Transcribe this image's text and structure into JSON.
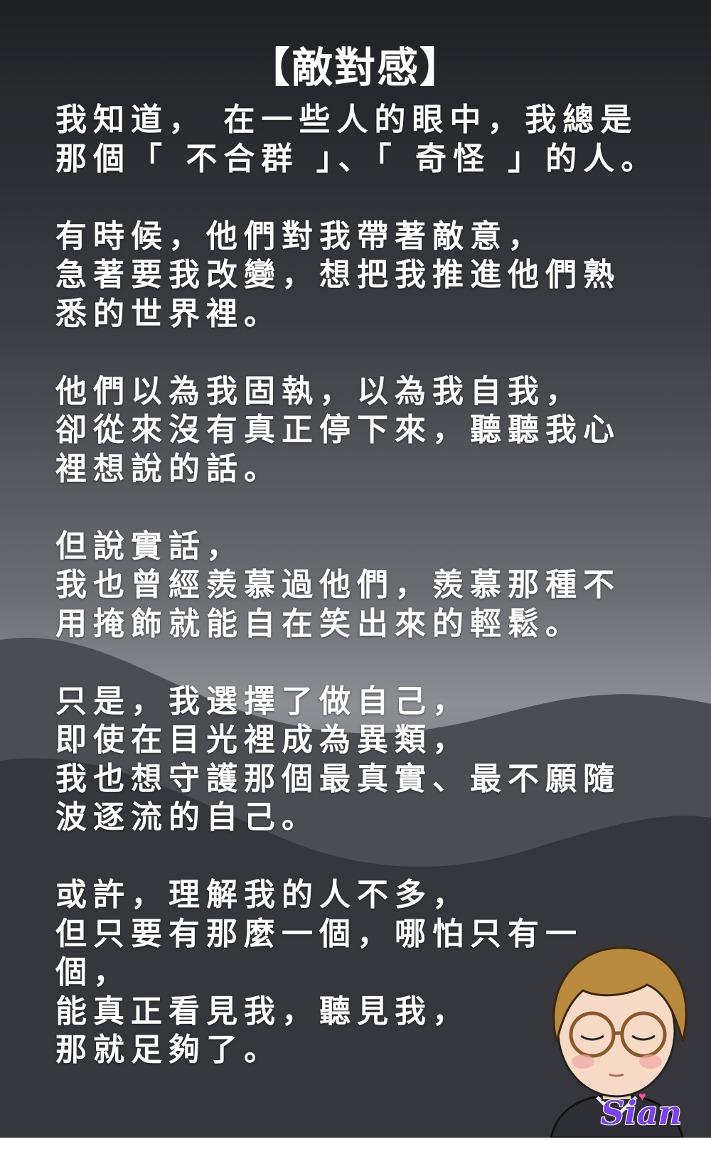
{
  "title": "【敵對感】",
  "stanzas": [
    [
      "我知道， 在一些人的眼中，我總是",
      "那個「 不合群 」、「 奇怪 」的人。"
    ],
    [
      "有時候，他們對我帶著敵意，",
      "急著要我改變，想把我推進他們熟",
      "悉的世界裡。"
    ],
    [
      "他們以為我固執，以為我自我，",
      "卻從來沒有真正停下來，聽聽我心",
      "裡想說的話。"
    ],
    [
      "但說實話，",
      "我也曾經羨慕過他們，羨慕那種不",
      "用掩飾就能自在笑出來的輕鬆。"
    ],
    [
      "只是，我選擇了做自己，",
      "即使在目光裡成為異類，",
      "我也想守護那個最真實、最不願隨",
      "波逐流的自己。"
    ],
    [
      "或許，理解我的人不多，",
      "但只要有那麼一個，哪怕只有一",
      "個，",
      "能真正看見我，聽見我，",
      "那就足夠了。"
    ]
  ],
  "signature": "Sian",
  "colors": {
    "text": "#ffffff",
    "signature": "#7a3ff0",
    "heart": "#ff4f9a"
  },
  "icons": {
    "avatar": "cartoon-avatar-icon",
    "heart": "heart-icon"
  }
}
